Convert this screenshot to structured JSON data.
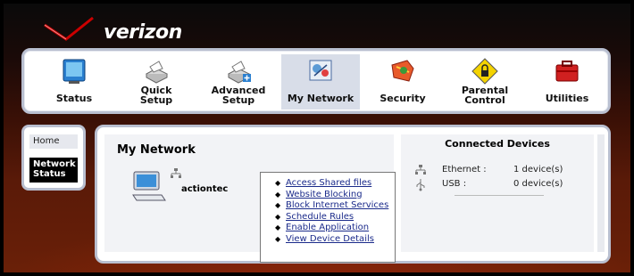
{
  "brand": {
    "name": "verizon",
    "colors": {
      "accent": "#cc0000",
      "nav_active": "#d8dde8",
      "link": "#1a2a8a"
    }
  },
  "nav": {
    "items": [
      {
        "label": "Status",
        "icon": "status-icon",
        "active": false
      },
      {
        "label": "Quick Setup",
        "line1": "Quick",
        "line2": "Setup",
        "icon": "quick-setup-icon",
        "active": false
      },
      {
        "label": "Advanced Setup",
        "line1": "Advanced",
        "line2": "Setup",
        "icon": "advanced-setup-icon",
        "active": false
      },
      {
        "label": "My Network",
        "icon": "my-network-icon",
        "active": true
      },
      {
        "label": "Security",
        "icon": "security-icon",
        "active": false
      },
      {
        "label": "Parental Control",
        "line1": "Parental",
        "line2": "Control",
        "icon": "parental-control-icon",
        "active": false
      },
      {
        "label": "Utilities",
        "icon": "utilities-icon",
        "active": false
      }
    ]
  },
  "sidebar": {
    "items": [
      {
        "label": "Home",
        "active": false
      },
      {
        "label_line1": "Network",
        "label_line2": "Status",
        "active": true
      }
    ]
  },
  "main": {
    "title": "My Network",
    "device": {
      "name": "actiontec",
      "icon": "computer-icon"
    },
    "links": [
      "Access Shared files",
      "Website Blocking",
      "Block Internet Services",
      "Schedule Rules",
      "Enable Application",
      "View Device Details"
    ]
  },
  "connected": {
    "title": "Connected Devices",
    "rows": [
      {
        "label": "Ethernet :",
        "value": "1 device(s)",
        "icon": "ethernet-icon"
      },
      {
        "label": "USB :",
        "value": "0 device(s)",
        "icon": "usb-icon"
      }
    ]
  }
}
